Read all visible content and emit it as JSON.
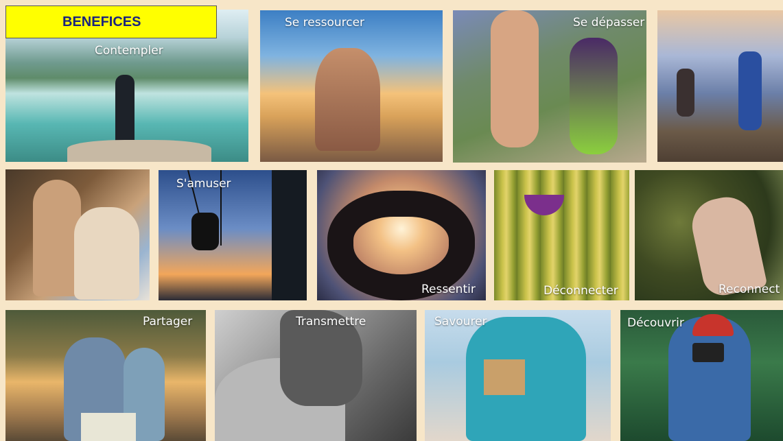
{
  "banner": {
    "title": "BENEFICES"
  },
  "tiles": {
    "contempler": "Contempler",
    "ressourcer": "Se ressourcer",
    "depasser": "Se dépasser",
    "amuser": "S'amuser",
    "ressentir": "Ressentir",
    "deconnecter": "Déconnecter",
    "reconnect": "Reconnect",
    "partager": "Partager",
    "transmettre": "Transmettre",
    "savourer": "Savourer",
    "decouvrir": "Découvrir"
  }
}
